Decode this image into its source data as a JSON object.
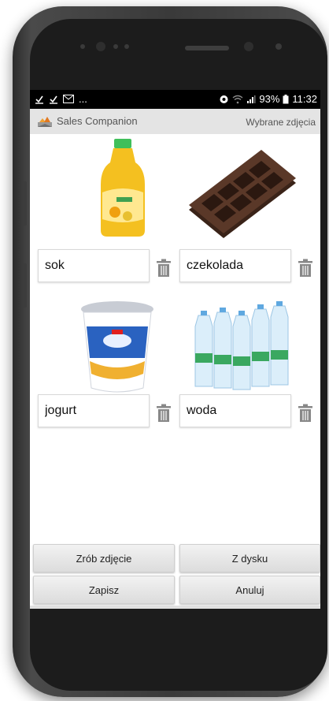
{
  "statusbar": {
    "left_icons": [
      "download-done-icon",
      "download-done-icon",
      "mail-icon"
    ],
    "ellipsis": "...",
    "battery": "93%",
    "time": "11:32"
  },
  "appbar": {
    "title": "Sales Companion",
    "subtitle": "Wybrane zdjęcia"
  },
  "items": [
    {
      "name": "sok",
      "image": "juice-bottle"
    },
    {
      "name": "czekolada",
      "image": "chocolate-bar"
    },
    {
      "name": "jogurt",
      "image": "yogurt-cup"
    },
    {
      "name": "woda",
      "image": "water-bottles"
    }
  ],
  "buttons": {
    "take_photo": "Zrób zdjęcie",
    "from_disk": "Z dysku",
    "save": "Zapisz",
    "cancel": "Anuluj"
  },
  "colors": {
    "appbar_bg": "#e4e4e4",
    "statusbar_bg": "#000000"
  }
}
